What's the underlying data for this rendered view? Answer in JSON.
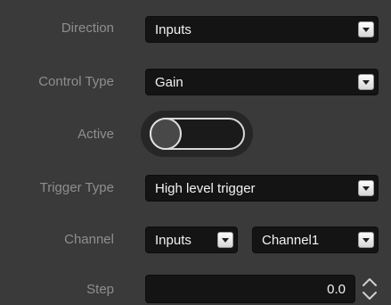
{
  "form": {
    "direction": {
      "label": "Direction",
      "value": "Inputs"
    },
    "control_type": {
      "label": "Control Type",
      "value": "Gain"
    },
    "active": {
      "label": "Active",
      "state": "off"
    },
    "trigger_type": {
      "label": "Trigger Type",
      "value": "High level trigger"
    },
    "channel": {
      "label": "Channel",
      "source_value": "Inputs",
      "channel_value": "Channel1"
    },
    "step": {
      "label": "Step",
      "value": "0.0"
    }
  },
  "colors": {
    "background": "#3a3a3a",
    "field_background": "#141414",
    "label_text": "#8e8e8e",
    "value_text": "#f2f2f2"
  },
  "icons": {
    "dropdown": "chevron-down-icon",
    "spin_up": "chevron-up-icon",
    "spin_down": "chevron-down-icon"
  }
}
